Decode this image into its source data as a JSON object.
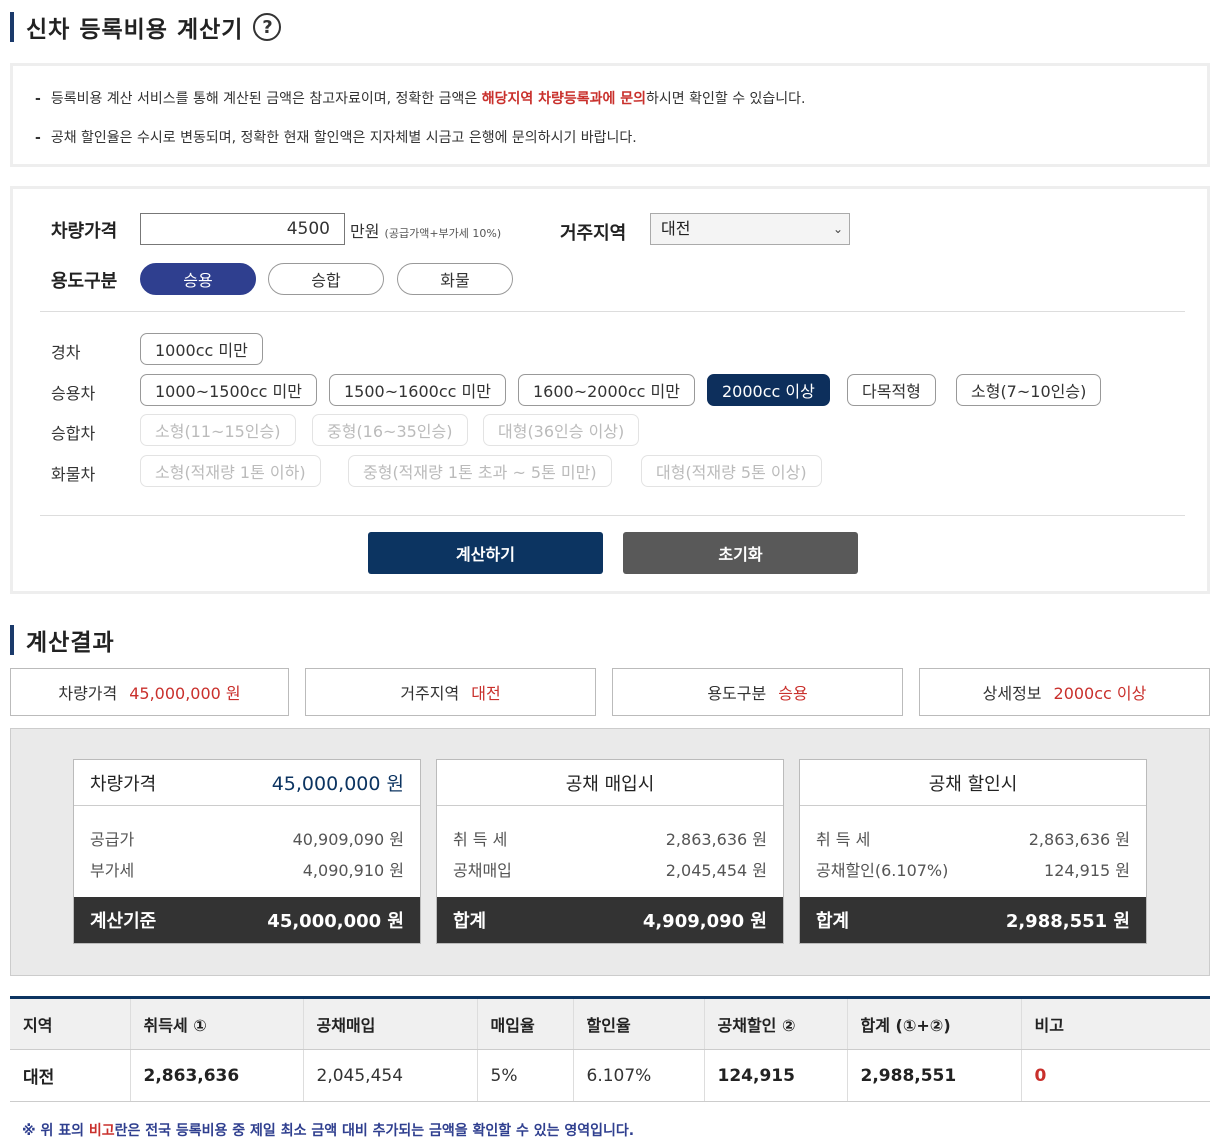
{
  "title": "신차 등록비용 계산기",
  "help_icon_glyph": "?",
  "notices": [
    {
      "pre": "등록비용 계산 서비스를 통해 계산된 금액은 참고자료이며, 정확한 금액은 ",
      "highlight": "해당지역 차량등록과에 문의",
      "post": "하시면 확인할 수 있습니다."
    },
    {
      "pre": "공채 할인율은 수시로 변동되며, 정확한 현재 할인액은 지자체별 시금고 은행에 문의하시기 바랍니다.",
      "highlight": "",
      "post": ""
    }
  ],
  "form": {
    "price_label": "차량가격",
    "price_value": "4500",
    "price_unit": "만원",
    "price_unit_note": "(공급가액+부가세 10%)",
    "region_label": "거주지역",
    "region_value": "대전",
    "usage_label": "용도구분",
    "usage_options": [
      "승용",
      "승합",
      "화물"
    ],
    "usage_selected": "승용",
    "categories": [
      {
        "label": "경차",
        "options": [
          "1000cc 미만"
        ]
      },
      {
        "label": "승용차",
        "options": [
          "1000~1500cc 미만",
          "1500~1600cc 미만",
          "1600~2000cc 미만",
          "2000cc 이상",
          "다목적형",
          "소형(7~10인승)"
        ]
      },
      {
        "label": "승합차",
        "options": [
          "소형(11~15인승)",
          "중형(16~35인승)",
          "대형(36인승 이상)"
        ]
      },
      {
        "label": "화물차",
        "options": [
          "소형(적재량 1톤 이하)",
          "중형(적재량 1톤 초과 ~ 5톤 미만)",
          "대형(적재량 5톤 이상)"
        ]
      }
    ],
    "selected_option": "2000cc 이상",
    "calc_button": "계산하기",
    "reset_button": "초기화"
  },
  "result": {
    "title": "계산결과",
    "summary": [
      {
        "label": "차량가격",
        "value": "45,000,000 원"
      },
      {
        "label": "거주지역",
        "value": "대전"
      },
      {
        "label": "용도구분",
        "value": "승용"
      },
      {
        "label": "상세정보",
        "value": "2000cc 이상"
      }
    ],
    "cards": [
      {
        "head_label": "차량가격",
        "head_value": "45,000,000 원",
        "rows": [
          {
            "label": "공급가",
            "value": "40,909,090 원"
          },
          {
            "label": "부가세",
            "value": "4,090,910 원"
          }
        ],
        "foot_label": "계산기준",
        "foot_value": "45,000,000 원"
      },
      {
        "head_label": "공채 매입시",
        "head_value": "",
        "rows": [
          {
            "label": "취 득 세",
            "value": "2,863,636 원"
          },
          {
            "label": "공채매입",
            "value": "2,045,454 원"
          }
        ],
        "foot_label": "합계",
        "foot_value": "4,909,090 원"
      },
      {
        "head_label": "공채 할인시",
        "head_value": "",
        "rows": [
          {
            "label": "취 득 세",
            "value": "2,863,636 원"
          },
          {
            "label": "공채할인(6.107%)",
            "value": "124,915 원"
          }
        ],
        "foot_label": "합계",
        "foot_value": "2,988,551 원"
      }
    ],
    "table": {
      "headers": [
        "지역",
        "취득세 ①",
        "공채매입",
        "매입율",
        "할인율",
        "공채할인 ②",
        "합계 (①+②)",
        "비고"
      ],
      "row": [
        "대전",
        "2,863,636",
        "2,045,454",
        "5%",
        "6.107%",
        "124,915",
        "2,988,551",
        "0"
      ]
    },
    "footnote": {
      "pre": "※ 위 표의 ",
      "highlight": "비고",
      "post": "란은 전국 등록비용 중 제일 최소 금액 대비 추가되는 금액을 확인할 수 있는 영역입니다."
    }
  },
  "colors": {
    "accent": "#0c3461",
    "active_pill": "#2f3f8f",
    "highlight_red": "#c9302c",
    "reset_gray": "#595959"
  }
}
